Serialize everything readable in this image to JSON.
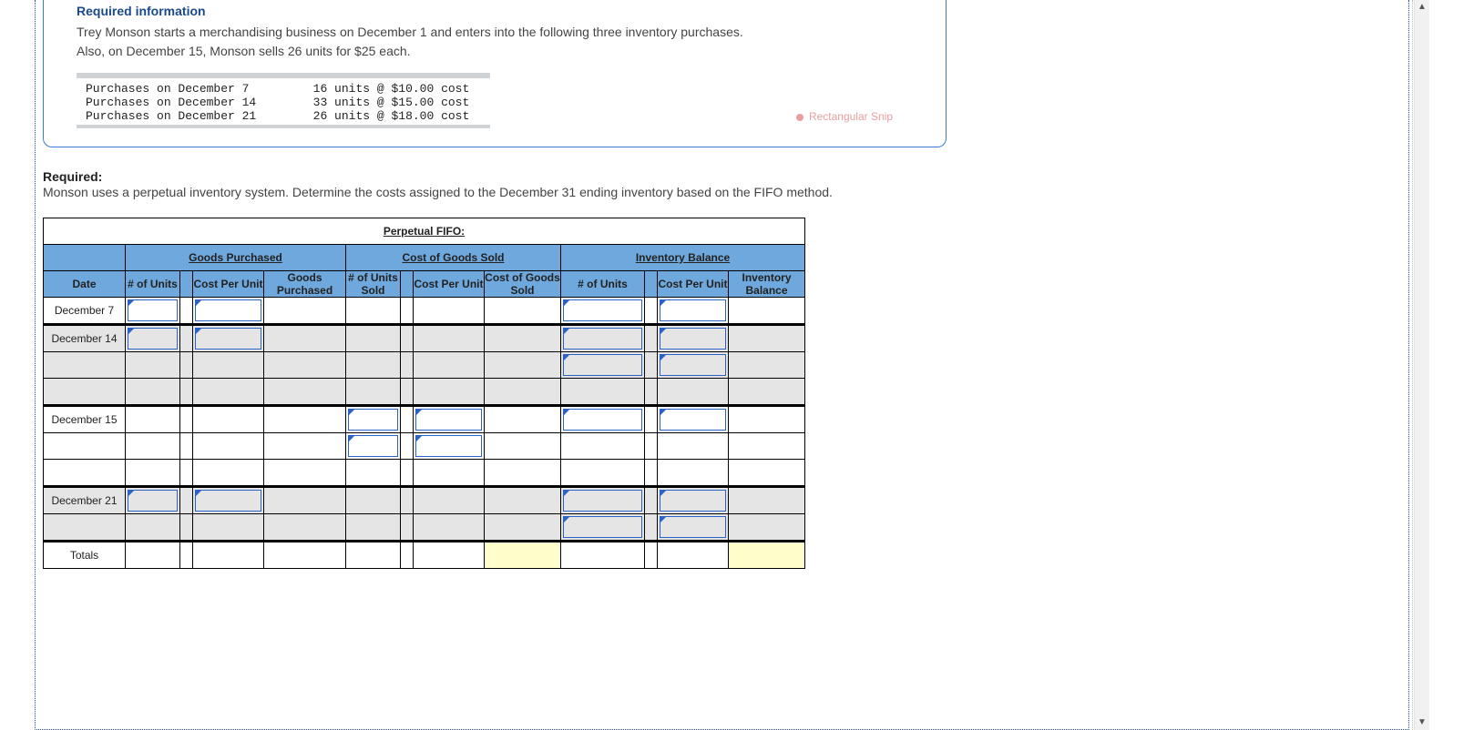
{
  "info": {
    "heading": "Required information",
    "p1": "Trey Monson starts a merchandising business on December 1 and enters into the following three inventory purchases.",
    "p2": "Also, on December 15, Monson sells 26 units for $25 each.",
    "lines": {
      "l1a": "Purchases on December 7",
      "l1b": "16 units @ $10.00 cost",
      "l2a": "Purchases on December 14",
      "l2b": "33 units @ $15.00 cost",
      "l3a": "Purchases on December 21",
      "l3b": "26 units @ $18.00 cost"
    },
    "snip": "Rectangular Snip"
  },
  "required": {
    "label": "Required:",
    "text": "Monson uses a perpetual inventory system. Determine the costs assigned to the December 31 ending inventory based on the FIFO method."
  },
  "table": {
    "title": "Perpetual FIFO:",
    "group": {
      "gp": "Goods Purchased",
      "cogs": "Cost of Goods Sold",
      "inv": "Inventory Balance"
    },
    "head": {
      "date": "Date",
      "gp_units": "# of Units",
      "gp_cost": "Cost Per Unit",
      "gp_total": "Goods Purchased",
      "cogs_units": "# of Units Sold",
      "cogs_cost": "Cost Per Unit",
      "cogs_total": "Cost of Goods Sold",
      "inv_units": "# of Units",
      "inv_cost": "Cost Per Unit",
      "inv_total": "Inventory Balance"
    },
    "rows": {
      "r1": "December 7",
      "r2": "December 14",
      "r3": "December 15",
      "r4": "December 21",
      "totals": "Totals"
    }
  }
}
